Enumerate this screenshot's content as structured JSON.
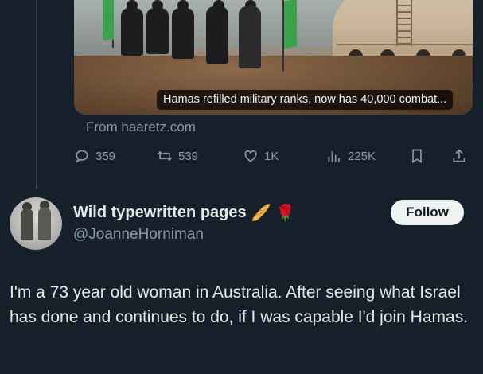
{
  "link_card": {
    "caption": "Hamas refilled military ranks, now has 40,000 combat...",
    "source": "From haaretz.com"
  },
  "actions": {
    "replies": "359",
    "reposts": "539",
    "likes": "1K",
    "views": "225K"
  },
  "tweet": {
    "display_name": "Wild typewritten pages",
    "name_emojis": "🥖 🌹",
    "handle": "@JoanneHorniman",
    "follow_label": "Follow",
    "text": "I'm a 73 year old woman in Australia. After seeing what Israel has done and continues to do, if I was capable I'd join Hamas."
  },
  "colors": {
    "background": "#15202b",
    "text_primary": "#e7e9ea",
    "text_secondary": "#8b98a5",
    "follow_bg": "#eff3f4"
  }
}
